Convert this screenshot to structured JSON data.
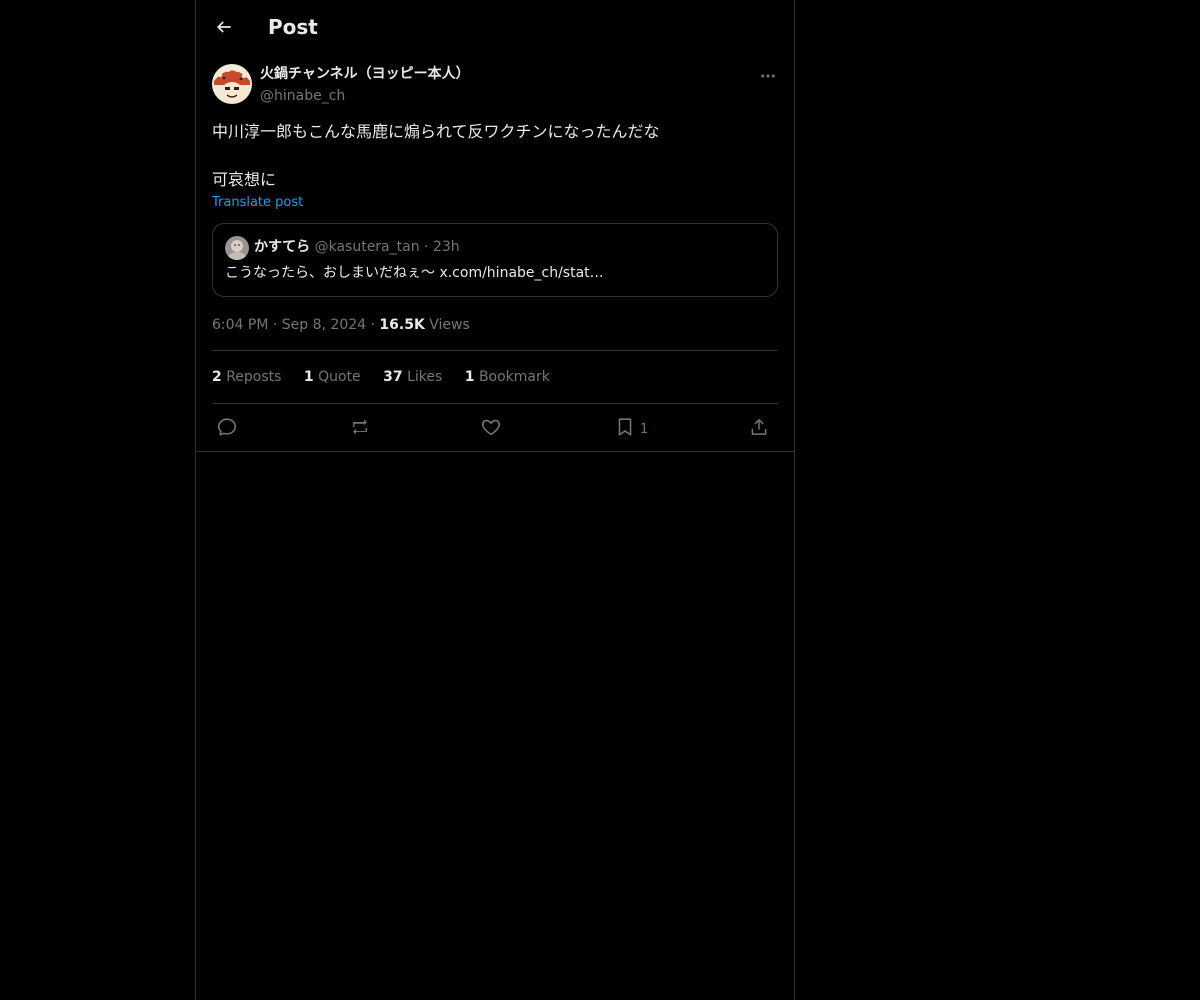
{
  "header": {
    "title": "Post",
    "back_icon": "arrow-left-icon"
  },
  "post": {
    "author": {
      "name": "火鍋チャンネル（ヨッピー本人）",
      "handle": "@hinabe_ch"
    },
    "text_line_1": "中川淳一郎もこんな馬鹿に煽られて反ワクチンになったんだな",
    "text_line_2": "可哀想に",
    "translate_label": "Translate post",
    "quote": {
      "name": "かすてら",
      "handle": "@kasutera_tan",
      "separator": "·",
      "time": "23h",
      "text": "こうなったら、おしまいだねぇ〜 x.com/hinabe_ch/stat…"
    },
    "meta": {
      "time": "6:04 PM",
      "separator": "·",
      "date": "Sep 8, 2024",
      "views_count": "16.5K",
      "views_label": "Views"
    },
    "stats": {
      "reposts_count": "2",
      "reposts_label": "Reposts",
      "quotes_count": "1",
      "quotes_label": "Quote",
      "likes_count": "37",
      "likes_label": "Likes",
      "bookmarks_count": "1",
      "bookmarks_label": "Bookmark"
    },
    "actions": {
      "bookmark_count": "1"
    }
  },
  "colors": {
    "background": "#000000",
    "text_primary": "#e7e9ea",
    "text_secondary": "#71767b",
    "accent_link": "#1d9bf0",
    "border": "#2f3336"
  }
}
